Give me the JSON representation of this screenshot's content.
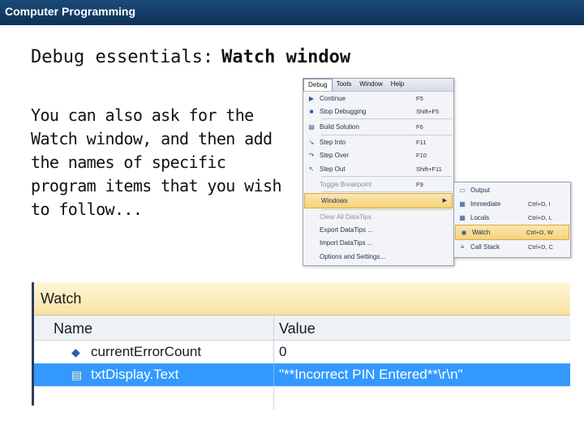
{
  "header": {
    "course": "Computer Programming"
  },
  "slide": {
    "title_part1": "Debug essentials:",
    "title_part2": "Watch window",
    "body": "You can also ask for the Watch window, and then add the names of specific program items that you wish to follow..."
  },
  "menubar": [
    "Debug",
    "Tools",
    "Window",
    "Help"
  ],
  "debug_menu": [
    {
      "icon": "play-icon",
      "glyph": "▶",
      "label": "Continue",
      "shortcut": "F5"
    },
    {
      "icon": "stop-icon",
      "glyph": "■",
      "label": "Stop Debugging",
      "shortcut": "Shift+F5"
    },
    {
      "icon": "build-icon",
      "glyph": "▤",
      "label": "Build Solution",
      "shortcut": "F6"
    },
    {
      "icon": "step-into-icon",
      "glyph": "↘",
      "label": "Step Into",
      "shortcut": "F11"
    },
    {
      "icon": "step-over-icon",
      "glyph": "↷",
      "label": "Step Over",
      "shortcut": "F10"
    },
    {
      "icon": "step-out-icon",
      "glyph": "↖",
      "label": "Step Out",
      "shortcut": "Shift+F11"
    },
    {
      "icon": "breakpoint-icon",
      "glyph": "",
      "label": "Toggle Breakpoint",
      "shortcut": "F9",
      "disabled": true
    },
    {
      "icon": "windows-icon",
      "glyph": "",
      "label": "Windows",
      "shortcut": "",
      "highlight": true,
      "submenu": true
    },
    {
      "icon": "",
      "glyph": "",
      "label": "Clear All DataTips",
      "shortcut": "",
      "disabled": true
    },
    {
      "icon": "",
      "glyph": "",
      "label": "Export DataTips ...",
      "shortcut": ""
    },
    {
      "icon": "",
      "glyph": "",
      "label": "Import DataTips ...",
      "shortcut": ""
    },
    {
      "icon": "",
      "glyph": "",
      "label": "Options and Settings...",
      "shortcut": ""
    }
  ],
  "windows_submenu": [
    {
      "icon": "output-icon",
      "glyph": "▭",
      "label": "Output",
      "shortcut": ""
    },
    {
      "icon": "immediate-icon",
      "glyph": "▦",
      "label": "Immediate",
      "shortcut": "Ctrl+D, I"
    },
    {
      "icon": "locals-icon",
      "glyph": "▦",
      "label": "Locals",
      "shortcut": "Ctrl+D, L"
    },
    {
      "icon": "watch-icon",
      "glyph": "◉",
      "label": "Watch",
      "shortcut": "Ctrl+D, W",
      "highlight": true
    },
    {
      "icon": "call-stack-icon",
      "glyph": "≡",
      "label": "Call Stack",
      "shortcut": "Ctrl+D, C"
    }
  ],
  "watch": {
    "title": "Watch",
    "col_name": "Name",
    "col_value": "Value",
    "rows": [
      {
        "name": "currentErrorCount",
        "value": "0",
        "selected": false
      },
      {
        "name": "txtDisplay.Text",
        "value": "\"**Incorrect PIN Entered**\\r\\n\"",
        "selected": true
      }
    ]
  },
  "colors": {
    "selection": "#3399ff",
    "menu_highlight": "#f6d27a",
    "header_bar": "#0d3157"
  }
}
